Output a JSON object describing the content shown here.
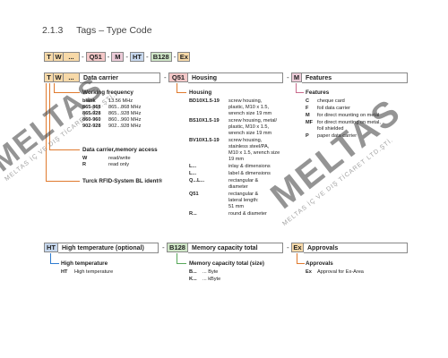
{
  "heading": {
    "number": "2.1.3",
    "title": "Tags – Type Code"
  },
  "code": [
    "T",
    "W",
    "...",
    "-",
    "Q51",
    "-",
    "M",
    "-",
    "HT",
    "-",
    "B128",
    "-",
    "Ex"
  ],
  "colors": {
    "tw_box": "#f7d9a8",
    "q51_box": "#f4c8c8",
    "m_box": "#eccbd8",
    "ht_box": "#c7d8ee",
    "b128_box": "#cfe6c7",
    "ex_box": "#f7d9a8"
  },
  "data_carrier": {
    "code": [
      "T",
      "W",
      "..."
    ],
    "title": "Data carrier",
    "working_frequency": {
      "label": "Working frequency",
      "rows": [
        [
          "blank",
          "13.56 MHz"
        ],
        [
          "865-868",
          "865...868 MHz"
        ],
        [
          "865-928",
          "865...928 MHz"
        ],
        [
          "860-960",
          "860...960 MHz"
        ],
        [
          "902-928",
          "902...928 MHz"
        ]
      ]
    },
    "memory_access": {
      "label": "Data carrier,memory access",
      "rows": [
        [
          "W",
          "read/write"
        ],
        [
          "R",
          "read only"
        ]
      ]
    },
    "ident": "Turck RFID-System BL ident®"
  },
  "housing": {
    "code": "Q51",
    "title": "Housing",
    "label": "Housing",
    "rows": [
      [
        "BD10X1.5-19",
        "screw housing,",
        "plastic, M10 x 1.5,",
        "wrench size 19 mm"
      ],
      [
        "BS10X1.5-19",
        "screw housing, metal/",
        "plastic, M10 x 1.5,",
        "wrench size 19 mm"
      ],
      [
        "BV10X1.5-19",
        "screw housing,",
        "stainless steel/PA,",
        "M10 x 1.5, wrench size",
        "19 mm"
      ],
      [
        "L...",
        "inlay & dimensions"
      ],
      [
        "L...",
        "label & dimensions"
      ],
      [
        "Q...L...",
        "rectangular &",
        "diameter"
      ],
      [
        "Q51",
        "rectangular &",
        "lateral length:",
        "51 mm"
      ],
      [
        "R...",
        "round & diameter"
      ]
    ]
  },
  "features": {
    "code": "M",
    "title": "Features",
    "label": "Features",
    "rows": [
      [
        "C",
        "cheque card"
      ],
      [
        "F",
        "foil data carrier"
      ],
      [
        "M",
        "for direct mounting on metal"
      ],
      [
        "MF",
        "for direct mounting on metal,",
        "foil shielded"
      ],
      [
        "P",
        "paper data carrier"
      ]
    ]
  },
  "high_temp": {
    "code": "HT",
    "title": "High temperature (optional)",
    "label": "High temperature",
    "rows": [
      [
        "HT",
        "High temperature"
      ]
    ]
  },
  "memory": {
    "code": "B128",
    "title": "Memory capacity total",
    "label": "Memory capacity total (size)",
    "rows": [
      [
        "B...",
        "... Byte"
      ],
      [
        "K...",
        "... kByte"
      ]
    ]
  },
  "approvals": {
    "code": "Ex",
    "title": "Approvals",
    "label": "Approvals",
    "rows": [
      [
        "Ex",
        "Approval for Ex-Area"
      ]
    ]
  },
  "watermark": {
    "brand": "MELTAS",
    "caption": "MELTAS İÇ VE DIŞ TİCARET LTD.ŞTİ."
  }
}
